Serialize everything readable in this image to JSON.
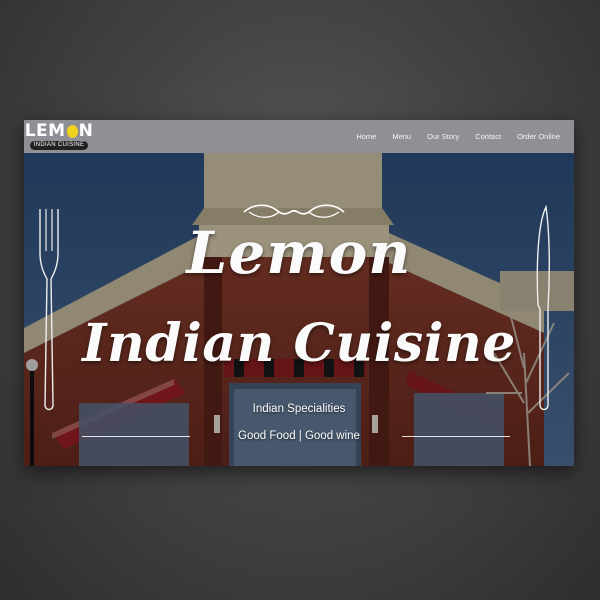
{
  "logo": {
    "word_start": "LEM",
    "word_end": "N",
    "subtitle": "INDIAN CUISINE",
    "accent": "#f1d21e"
  },
  "nav": {
    "items": [
      {
        "label": "Home"
      },
      {
        "label": "Menu"
      },
      {
        "label": "Our Story"
      },
      {
        "label": "Contact"
      },
      {
        "label": "Order Online"
      }
    ],
    "background": "#8e9096"
  },
  "hero": {
    "title_line1": "Lemon",
    "title_line2": "Indian Cuisine",
    "subtitle1": "Indian Specialities",
    "subtitle2": "Good Food | Good wine",
    "icons": [
      "flourish-ornament",
      "fork-icon",
      "knife-icon"
    ]
  }
}
